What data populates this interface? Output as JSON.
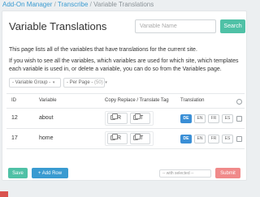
{
  "breadcrumb": {
    "items": [
      "Add-On Manager",
      "Transcribe",
      "Variable Translations"
    ],
    "separator": "/"
  },
  "page": {
    "title": "Variable Translations"
  },
  "search": {
    "placeholder": "Variable Name",
    "button_label": "Search"
  },
  "description": {
    "line1": "This page lists all of the variables that have translations for the current site.",
    "line2": "If you wish to see all the variables, which variables are used for which site, which templates each variable is used in, or delete a variable, you can do so from the Variables page."
  },
  "filters": {
    "variable_group": "- Variable Group -",
    "per_page": "- Per Page -",
    "per_page_count": "(50)"
  },
  "table": {
    "headers": {
      "id": "ID",
      "variable": "Variable",
      "copy": "Copy Replace / Translate Tag",
      "translation": "Translation"
    },
    "rows": [
      {
        "id": "12",
        "variable": "about",
        "copy_r": "R",
        "copy_t": "T"
      },
      {
        "id": "17",
        "variable": "home",
        "copy_r": "R",
        "copy_t": "T"
      }
    ],
    "languages": [
      "DE",
      "EN",
      "FR",
      "ES"
    ],
    "active_language": "DE"
  },
  "actions": {
    "save_label": "Save",
    "add_row_label": "+ Add Row",
    "with_selected": "-- with selected --",
    "submit_label": "Submit"
  },
  "colors": {
    "accent_green": "#4fc1a6",
    "accent_blue": "#3a9bd1",
    "language_active": "#3a8fd6",
    "submit_red": "#f08a8a"
  }
}
